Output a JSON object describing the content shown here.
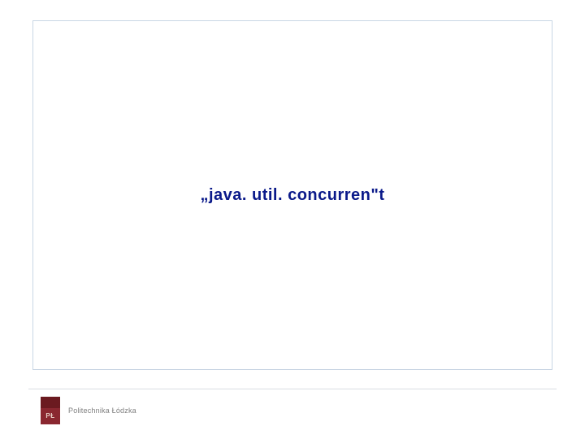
{
  "slide": {
    "title": "„java. util. concurren\"t"
  },
  "footer": {
    "logo_mark": "PŁ",
    "university": "Politechnika Łódzka"
  }
}
